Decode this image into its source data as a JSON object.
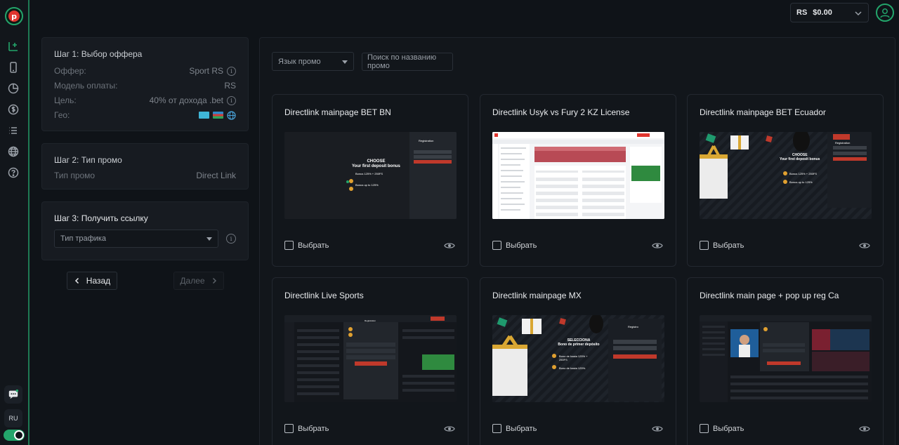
{
  "header": {
    "currency": "RS",
    "balance": "$0.00"
  },
  "sidebar": {
    "icons": [
      "add-offer-icon",
      "mobile-icon",
      "pie-chart-icon",
      "dollar-icon",
      "list-icon",
      "globe-icon",
      "help-icon"
    ],
    "lang": "RU"
  },
  "step1": {
    "title": "Шаг 1: Выбор оффера",
    "rows": [
      {
        "label": "Оффер:",
        "value": "Sport RS"
      },
      {
        "label": "Модель оплаты:",
        "value": "RS"
      },
      {
        "label": "Цель:",
        "value": "40% от дохода .bet"
      },
      {
        "label": "Гео:",
        "value": ""
      }
    ]
  },
  "step2": {
    "title": "Шаг 2: Тип промо",
    "row": {
      "label": "Тип промо",
      "value": "Direct Link"
    }
  },
  "step3": {
    "title": "Шаг 3: Получить ссылку",
    "traffic_placeholder": "Тип трафика"
  },
  "nav": {
    "back": "Назад",
    "next": "Далее"
  },
  "filters": {
    "lang_select": "Язык промо",
    "search_placeholder": "Поиск по названию промо"
  },
  "cards": [
    {
      "title": "Directlink mainpage BET BN",
      "select_label": "Выбрать"
    },
    {
      "title": "Directlink Usyk vs Fury 2 KZ License",
      "select_label": "Выбрать"
    },
    {
      "title": "Directlink mainpage BET Ecuador",
      "select_label": "Выбрать"
    },
    {
      "title": "Directlink Live Sports",
      "select_label": "Выбрать"
    },
    {
      "title": "Directlink mainpage MX",
      "select_label": "Выбрать"
    },
    {
      "title": "Directlink main page + pop up reg Ca",
      "select_label": "Выбрать"
    }
  ],
  "thumbs": {
    "bn": {
      "heading": "CHOOSE",
      "sub": "Your first deposit bonus",
      "bonus1": "Bonus 125% + 250FS",
      "bonus2": "Bonus up to 125%",
      "reg": "Registration"
    },
    "mx": {
      "heading": "SELECCIONA",
      "sub": "Bono de primer depósito",
      "bonus1": "Bono de hasta 125% + 250FS",
      "bonus2": "Bono de hasta 125%.",
      "reg": "Registro"
    },
    "ec": {
      "heading": "CHOOSE",
      "sub": "Your first deposit bonus",
      "bonus1": "Bonus 125% + 250FS",
      "bonus2": "Bonus up to 125%",
      "reg": "Registration"
    },
    "live": {
      "reg": "Registration"
    }
  },
  "colors": {
    "accent": "#23a56b",
    "danger": "#e0352e",
    "bg": "#0f1318",
    "card": "#171b21"
  }
}
